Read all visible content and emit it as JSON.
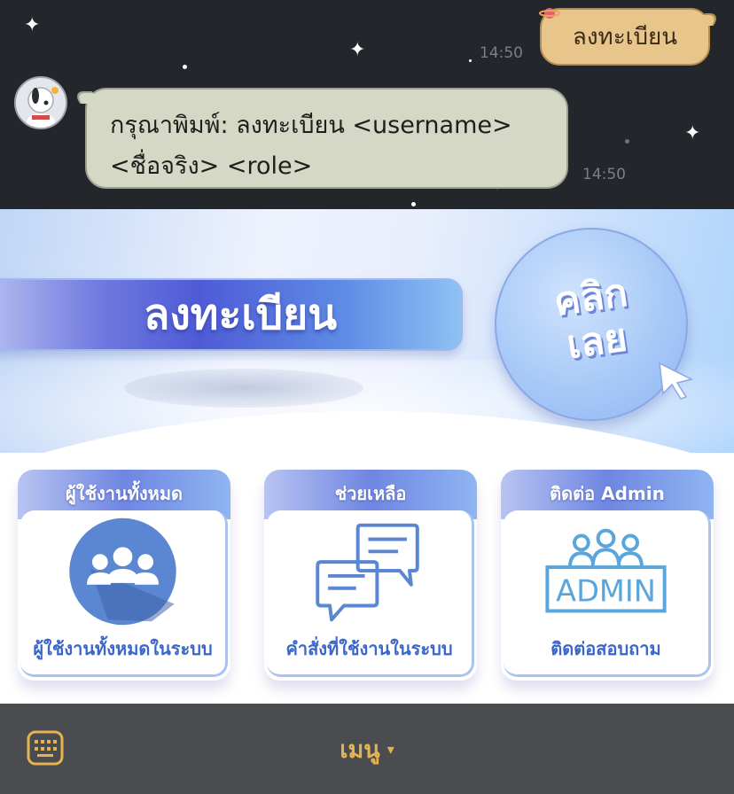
{
  "chat": {
    "outgoing": {
      "text": "ลงทะเบียน",
      "time": "14:50"
    },
    "incoming": {
      "line1": "กรุณาพิมพ์: ลงทะเบียน <username>",
      "line2": "<ชื่อจริง> <role>",
      "time": "14:50",
      "avatar_icon": "snoopy-astronaut-avatar"
    }
  },
  "richmenu": {
    "banner_label": "ลงทะเบียน",
    "click_line1": "คลิก",
    "click_line2": "เลย",
    "cards": [
      {
        "header": "ผู้ใช้งานทั้งหมด",
        "label": "ผู้ใช้งานทั้งหมดในระบบ",
        "icon": "users-group-icon"
      },
      {
        "header": "ช่วยเหลือ",
        "label": "คำสั่งที่ใช้งานในระบบ",
        "icon": "chat-bubbles-icon"
      },
      {
        "header": "ติดต่อ Admin",
        "label": "ติดต่อสอบถาม",
        "icon": "admin-desk-icon",
        "icon_text": "ADMIN"
      }
    ]
  },
  "bottombar": {
    "keyboard_icon": "keyboard-icon",
    "menu_label": "เมนู",
    "caret": "▾"
  },
  "colors": {
    "chat_bg": "#23262b",
    "outgoing_bubble": "#e7c58b",
    "incoming_bubble": "#d6d8c6",
    "accent_blue": "#3a67c9",
    "bottombar_bg": "#4a4c50",
    "menu_label": "#e6b34f"
  }
}
